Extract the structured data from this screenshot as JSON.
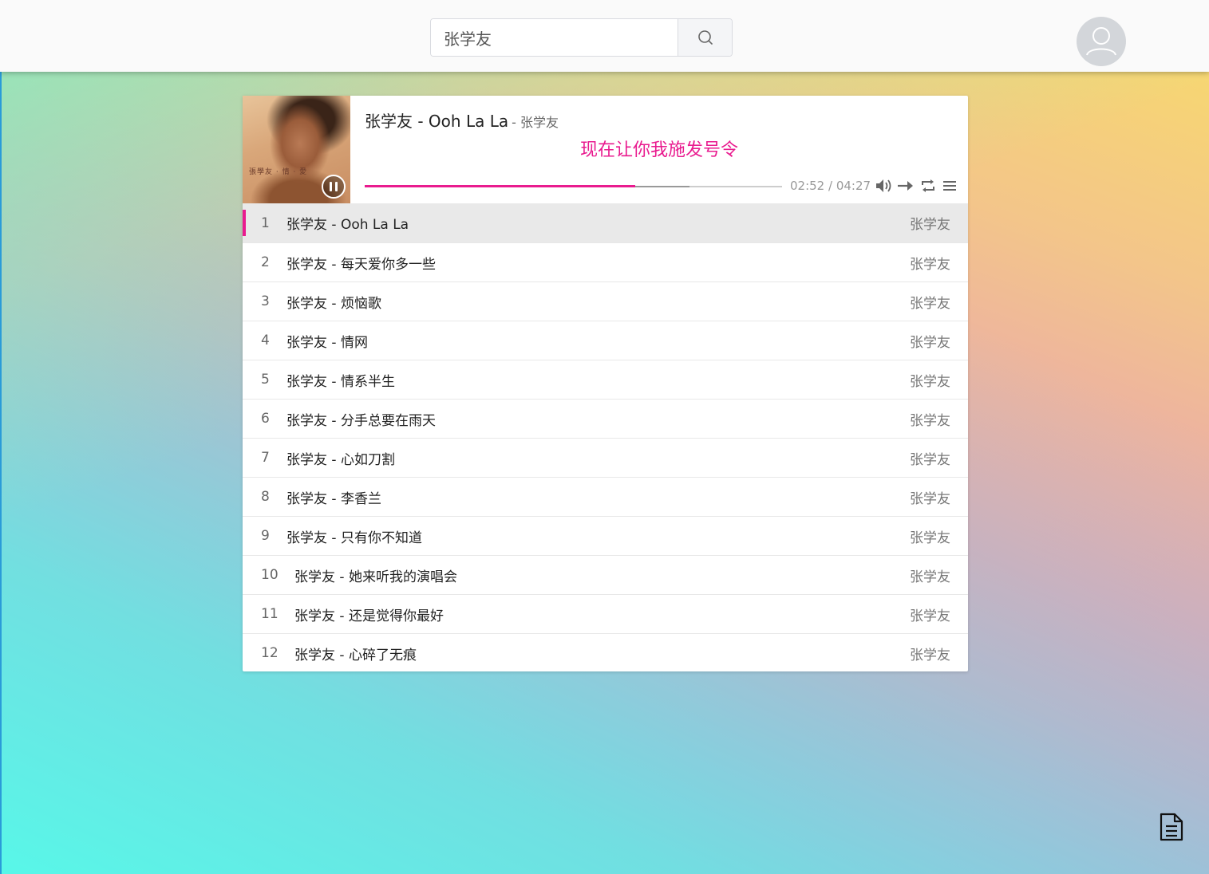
{
  "search": {
    "value": "张学友"
  },
  "player": {
    "title": "张学友 - Ooh La La",
    "artist": "- 张学友",
    "lyric": "现在让你我施发号令",
    "cover_text": "張學友 · 情 · 愛",
    "time": "02:52 / 04:27",
    "progress_played": 0.648,
    "progress_loaded": 0.778
  },
  "playlist": [
    {
      "num": "1",
      "title": "张学友 - Ooh La La",
      "artist": "张学友"
    },
    {
      "num": "2",
      "title": "张学友 - 每天爱你多一些",
      "artist": "张学友"
    },
    {
      "num": "3",
      "title": "张学友 - 烦恼歌",
      "artist": "张学友"
    },
    {
      "num": "4",
      "title": "张学友 - 情网",
      "artist": "张学友"
    },
    {
      "num": "5",
      "title": "张学友 - 情系半生",
      "artist": "张学友"
    },
    {
      "num": "6",
      "title": "张学友 - 分手总要在雨天",
      "artist": "张学友"
    },
    {
      "num": "7",
      "title": "张学友 - 心如刀割",
      "artist": "张学友"
    },
    {
      "num": "8",
      "title": "张学友 - 李香兰",
      "artist": "张学友"
    },
    {
      "num": "9",
      "title": "张学友 - 只有你不知道",
      "artist": "张学友"
    },
    {
      "num": "10",
      "title": "张学友 - 她来听我的演唱会",
      "artist": "张学友"
    },
    {
      "num": "11",
      "title": "张学友 - 还是觉得你最好",
      "artist": "张学友"
    },
    {
      "num": "12",
      "title": "张学友 - 心碎了无痕",
      "artist": "张学友"
    }
  ],
  "colors": {
    "accent": "#e91b8f"
  },
  "icons": [
    "search-icon",
    "user-icon",
    "pause-icon",
    "volume-icon",
    "order-icon",
    "loop-icon",
    "menu-icon",
    "document-icon"
  ]
}
